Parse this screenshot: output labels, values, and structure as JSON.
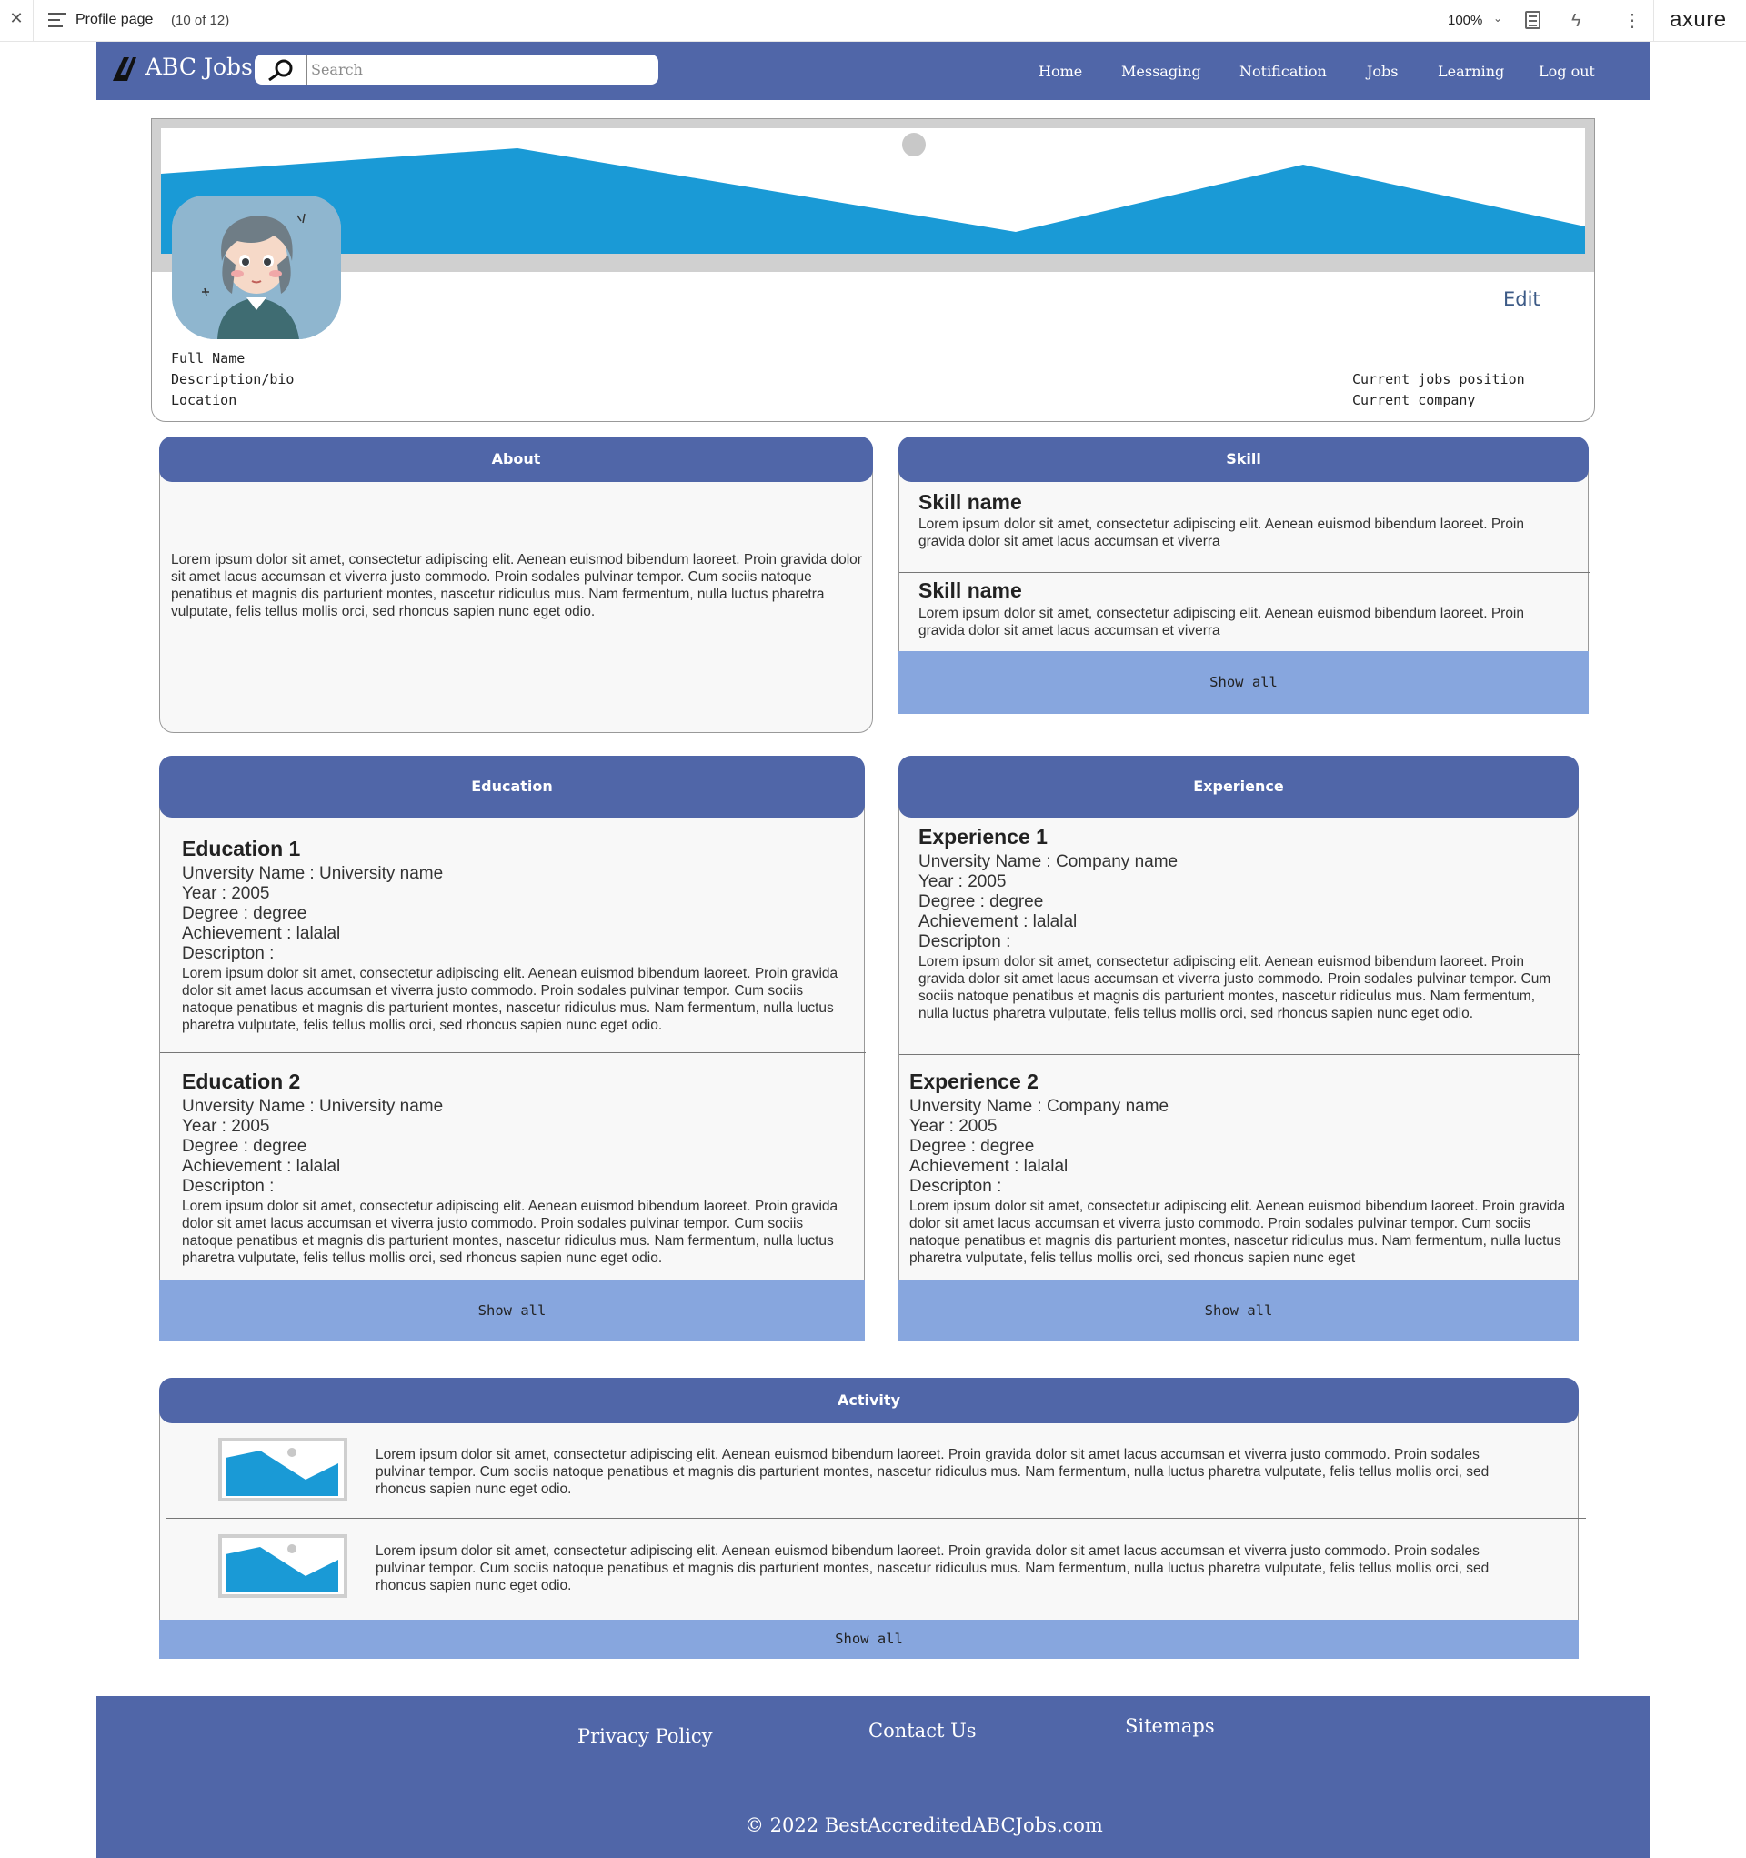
{
  "axure": {
    "page_name": "Profile page",
    "page_count": "(10 of 12)",
    "zoom": "100%",
    "brand": "axure"
  },
  "nav": {
    "logo_text": "ABC Jobs",
    "search_placeholder": "Search",
    "links": [
      "Home",
      "Messaging",
      "Notification",
      "Jobs",
      "Learning",
      "Log out"
    ]
  },
  "profile": {
    "edit_label": "Edit",
    "full_name": "Full Name",
    "bio": "Description/bio",
    "location": "Location",
    "current_position": "Current jobs position",
    "current_company": "Current company"
  },
  "about": {
    "heading": "About",
    "text": "Lorem ipsum dolor sit amet, consectetur adipiscing elit. Aenean euismod bibendum laoreet. Proin gravida dolor sit amet lacus accumsan et viverra justo commodo. Proin sodales pulvinar tempor. Cum sociis natoque penatibus et magnis dis parturient montes, nascetur ridiculus mus. Nam fermentum, nulla luctus pharetra vulputate, felis tellus mollis orci, sed rhoncus sapien nunc eget odio."
  },
  "skill": {
    "heading": "Skill",
    "items": [
      {
        "name": "Skill name",
        "text": "Lorem ipsum dolor sit amet, consectetur adipiscing elit. Aenean euismod bibendum laoreet. Proin gravida dolor sit amet lacus accumsan et viverra"
      },
      {
        "name": "Skill name",
        "text": "Lorem ipsum dolor sit amet, consectetur adipiscing elit. Aenean euismod bibendum laoreet. Proin gravida dolor sit amet lacus accumsan et viverra"
      }
    ],
    "show_all": "Show all"
  },
  "education": {
    "heading": "Education",
    "items": [
      {
        "title": "Education 1",
        "university": "Unversity Name : University name",
        "year": "Year : 2005",
        "degree": "Degree : degree",
        "achievement": "Achievement : lalalal",
        "desc_label": "Descripton :",
        "desc": "Lorem ipsum dolor sit amet, consectetur adipiscing elit. Aenean euismod bibendum laoreet. Proin gravida dolor sit amet lacus accumsan et viverra justo commodo. Proin sodales pulvinar tempor. Cum sociis natoque penatibus et magnis dis parturient montes, nascetur ridiculus mus. Nam fermentum, nulla luctus pharetra vulputate, felis tellus mollis orci, sed rhoncus sapien nunc eget odio."
      },
      {
        "title": "Education 2",
        "university": "Unversity Name : University name",
        "year": "Year : 2005",
        "degree": "Degree : degree",
        "achievement": "Achievement : lalalal",
        "desc_label": "Descripton :",
        "desc": "Lorem ipsum dolor sit amet, consectetur adipiscing elit. Aenean euismod bibendum laoreet. Proin gravida dolor sit amet lacus accumsan et viverra justo commodo. Proin sodales pulvinar tempor. Cum sociis natoque penatibus et magnis dis parturient montes, nascetur ridiculus mus. Nam fermentum, nulla luctus pharetra vulputate, felis tellus mollis orci, sed rhoncus sapien nunc eget odio."
      }
    ],
    "show_all": "Show all"
  },
  "experience": {
    "heading": "Experience",
    "items": [
      {
        "title": "Experience 1",
        "university": "Unversity Name : Company name",
        "year": "Year : 2005",
        "degree": "Degree : degree",
        "achievement": "Achievement : lalalal",
        "desc_label": "Descripton :",
        "desc": "Lorem ipsum dolor sit amet, consectetur adipiscing elit. Aenean euismod bibendum laoreet. Proin gravida dolor sit amet lacus accumsan et viverra justo commodo. Proin sodales pulvinar tempor. Cum sociis natoque penatibus et magnis dis parturient montes, nascetur ridiculus mus. Nam fermentum, nulla luctus pharetra vulputate, felis tellus mollis orci, sed rhoncus sapien nunc eget odio."
      },
      {
        "title": "Experience 2",
        "university": "Unversity Name : Company name",
        "year": "Year : 2005",
        "degree": "Degree : degree",
        "achievement": "Achievement : lalalal",
        "desc_label": "Descripton :",
        "desc": "Lorem ipsum dolor sit amet, consectetur adipiscing elit. Aenean euismod bibendum laoreet. Proin gravida dolor sit amet lacus accumsan et viverra justo commodo. Proin sodales pulvinar tempor. Cum sociis natoque penatibus et magnis dis parturient montes, nascetur ridiculus mus. Nam fermentum, nulla luctus pharetra vulputate, felis tellus mollis orci, sed rhoncus sapien nunc eget"
      }
    ],
    "show_all": "Show all"
  },
  "activity": {
    "heading": "Activity",
    "items": [
      {
        "text": "Lorem ipsum dolor sit amet, consectetur adipiscing elit. Aenean euismod bibendum laoreet. Proin gravida dolor sit amet lacus accumsan et viverra justo commodo. Proin sodales pulvinar tempor. Cum sociis natoque penatibus et magnis dis parturient montes, nascetur ridiculus mus. Nam fermentum, nulla luctus pharetra vulputate, felis tellus mollis orci, sed rhoncus sapien nunc eget odio."
      },
      {
        "text": "Lorem ipsum dolor sit amet, consectetur adipiscing elit. Aenean euismod bibendum laoreet. Proin gravida dolor sit amet lacus accumsan et viverra justo commodo. Proin sodales pulvinar tempor. Cum sociis natoque penatibus et magnis dis parturient montes, nascetur ridiculus mus. Nam fermentum, nulla luctus pharetra vulputate, felis tellus mollis orci, sed rhoncus sapien nunc eget odio."
      }
    ],
    "show_all": "Show all"
  },
  "footer": {
    "privacy": "Privacy Policy",
    "contact": "Contact Us",
    "sitemaps": "Sitemaps",
    "copyright": "© 2022 BestAccreditedABCJobs.com"
  },
  "colors": {
    "brand": "#5066a8",
    "show_all_bg": "#87a6de",
    "banner_blue": "#1a9ad6"
  }
}
